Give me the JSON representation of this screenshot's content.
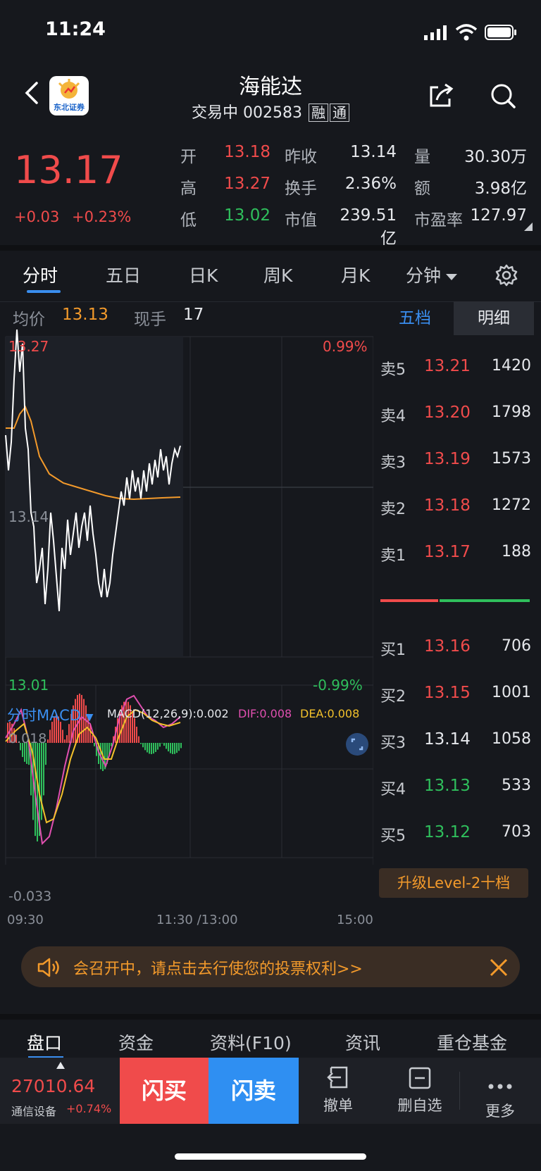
{
  "status": {
    "time": "11:24"
  },
  "header": {
    "logo_text": "东北证券",
    "title": "海能达",
    "status_text": "交易中",
    "code": "002583",
    "tags": [
      "融",
      "通"
    ]
  },
  "quote": {
    "price": "13.17",
    "change": "+0.03",
    "change_pct": "+0.23%",
    "fields": [
      {
        "label": "开",
        "value": "13.18",
        "color": "red"
      },
      {
        "label": "昨收",
        "value": "13.14",
        "color": "white"
      },
      {
        "label": "量",
        "value": "30.30万",
        "color": "white"
      },
      {
        "label": "高",
        "value": "13.27",
        "color": "red"
      },
      {
        "label": "换手",
        "value": "2.36%",
        "color": "white"
      },
      {
        "label": "额",
        "value": "3.98亿",
        "color": "white"
      },
      {
        "label": "低",
        "value": "13.02",
        "color": "green"
      },
      {
        "label": "市值",
        "value": "239.51亿",
        "color": "white"
      },
      {
        "label": "市盈率",
        "value": "127.97",
        "color": "white"
      }
    ]
  },
  "tabs": [
    "分时",
    "五日",
    "日K",
    "周K",
    "月K",
    "分钟"
  ],
  "chart": {
    "avg_label": "均价",
    "avg_value": "13.13",
    "hand_label": "现手",
    "hand_value": "17",
    "y_top": "13.27",
    "y_mid": "13.14",
    "y_bot": "13.01",
    "pct_top": "0.99%",
    "pct_bot": "-0.99%",
    "macd_title": "分时MACD",
    "macd_params": "MACD(12,26,9):0.002",
    "dif": "DIF:0.008",
    "dea": "DEA:0.008",
    "macd_top": "0.018",
    "macd_bot": "-0.033",
    "x_labels": [
      "09:30",
      "11:30 /13:00",
      "15:00"
    ]
  },
  "chart_data": {
    "type": "line",
    "ylim": [
      13.01,
      13.27
    ],
    "series": [],
    "macd_ylim": [
      -0.033,
      0.018
    ]
  },
  "orderbook": {
    "tab_active": "五档",
    "tab_other": "明细",
    "asks": [
      {
        "label": "卖5",
        "price": "13.21",
        "vol": "1420"
      },
      {
        "label": "卖4",
        "price": "13.20",
        "vol": "1798"
      },
      {
        "label": "卖3",
        "price": "13.19",
        "vol": "1573"
      },
      {
        "label": "卖2",
        "price": "13.18",
        "vol": "1272"
      },
      {
        "label": "卖1",
        "price": "13.17",
        "vol": "188"
      }
    ],
    "bids": [
      {
        "label": "买1",
        "price": "13.16",
        "vol": "706",
        "color": "red"
      },
      {
        "label": "买2",
        "price": "13.15",
        "vol": "1001",
        "color": "red"
      },
      {
        "label": "买3",
        "price": "13.14",
        "vol": "1058",
        "color": "white"
      },
      {
        "label": "买4",
        "price": "13.13",
        "vol": "533",
        "color": "green"
      },
      {
        "label": "买5",
        "price": "13.12",
        "vol": "703",
        "color": "green"
      }
    ],
    "upgrade": "升级Level-2十档"
  },
  "banner": {
    "text": "会召开中，请点击去行使您的投票权利>>"
  },
  "bottom_tabs": [
    "盘口",
    "资金",
    "资料(F10)",
    "资讯",
    "重仓基金"
  ],
  "bottom_bar": {
    "index_value": "27010.64",
    "index_name": "通信设备",
    "index_change": "+0.74%",
    "buy": "闪买",
    "sell": "闪卖",
    "cancel": "撤单",
    "remove": "删自选",
    "more": "更多"
  }
}
